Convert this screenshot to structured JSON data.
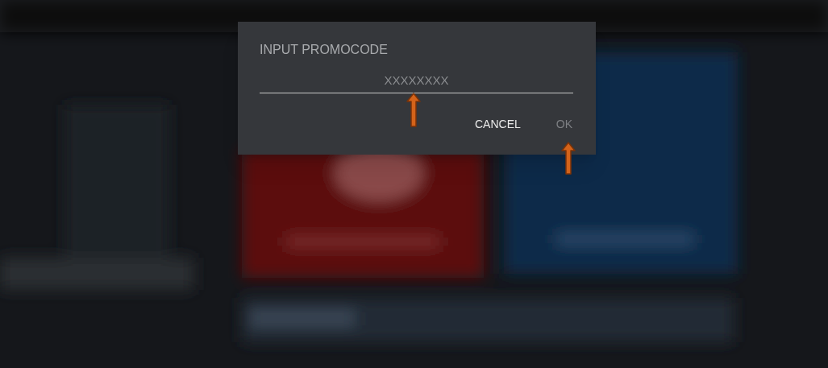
{
  "dialog": {
    "title": "INPUT PROMOCODE",
    "field": {
      "placeholder": "XXXXXXXX"
    },
    "buttons": [
      {
        "label": "CANCEL",
        "disabled": false
      },
      {
        "label": "OK",
        "disabled": true
      }
    ]
  }
}
